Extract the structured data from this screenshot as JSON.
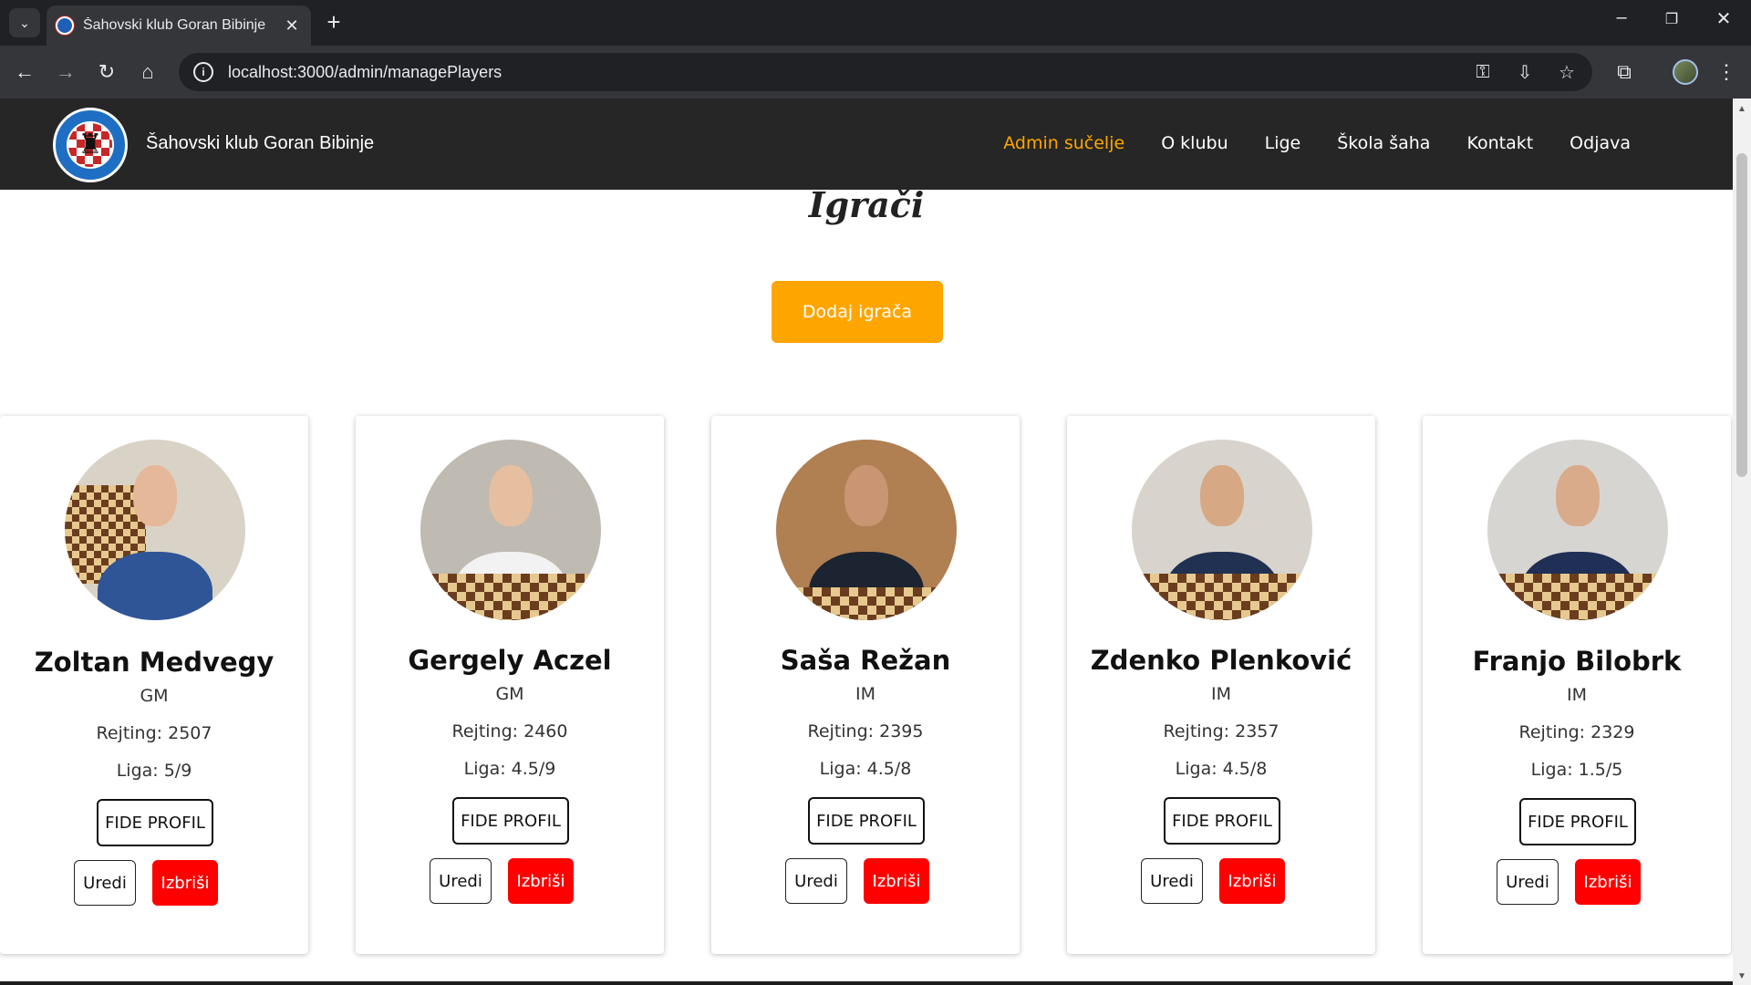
{
  "browser": {
    "tab_title": "Šahovski klub Goran Bibinje",
    "url": "localhost:3000/admin/managePlayers"
  },
  "site": {
    "brand": "Šahovski klub Goran Bibinje",
    "nav": [
      {
        "label": "Admin sučelje",
        "active": true
      },
      {
        "label": "O klubu"
      },
      {
        "label": "Lige"
      },
      {
        "label": "Škola šaha"
      },
      {
        "label": "Kontakt"
      },
      {
        "label": "Odjava"
      }
    ]
  },
  "page": {
    "title": "Igrači",
    "add_button": "Dodaj igrača"
  },
  "buttons": {
    "fide": "FIDE PROFIL",
    "edit": "Uredi",
    "delete": "Izbriši"
  },
  "players": [
    {
      "name": "Zoltan Medvegy",
      "title": "GM",
      "rating": "Rejting: 2507",
      "liga": "Liga: 5/9"
    },
    {
      "name": "Gergely Aczel",
      "title": "GM",
      "rating": "Rejting: 2460",
      "liga": "Liga: 4.5/9"
    },
    {
      "name": "Saša Režan",
      "title": "IM",
      "rating": "Rejting: 2395",
      "liga": "Liga: 4.5/8"
    },
    {
      "name": "Zdenko Plenković",
      "title": "IM",
      "rating": "Rejting: 2357",
      "liga": "Liga: 4.5/8"
    },
    {
      "name": "Franjo Bilobrk",
      "title": "IM",
      "rating": "Rejting: 2329",
      "liga": "Liga: 1.5/5"
    }
  ],
  "colors": {
    "accent": "#ffa500",
    "danger": "#ff0000",
    "navbar": "#262626"
  }
}
